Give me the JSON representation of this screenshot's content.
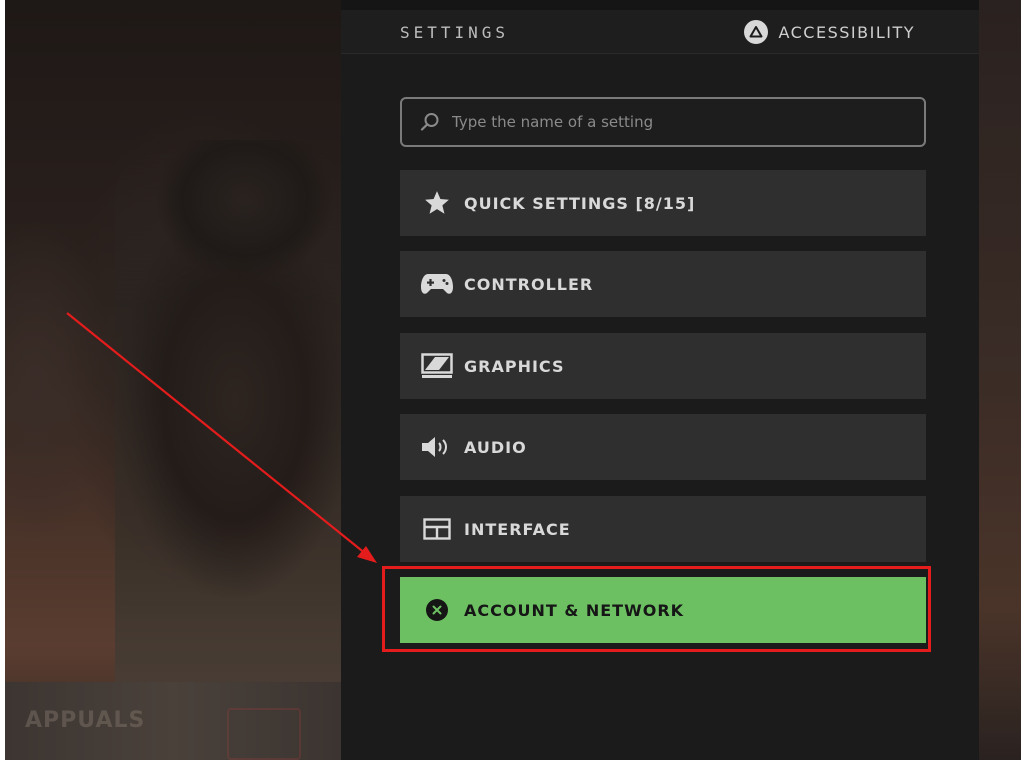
{
  "header": {
    "title": "SETTINGS",
    "accessibility_label": "ACCESSIBILITY"
  },
  "search": {
    "placeholder": "Type the name of a setting",
    "value": ""
  },
  "menu": {
    "items": [
      {
        "label": "QUICK SETTINGS [8/15]",
        "icon": "star-icon"
      },
      {
        "label": "CONTROLLER",
        "icon": "gamepad-icon"
      },
      {
        "label": "GRAPHICS",
        "icon": "monitor-icon"
      },
      {
        "label": "AUDIO",
        "icon": "speaker-icon"
      },
      {
        "label": "INTERFACE",
        "icon": "interface-icon"
      },
      {
        "label": "ACCOUNT & NETWORK",
        "icon": "x-circle-icon",
        "selected": true
      }
    ]
  },
  "watermark": {
    "text": "APPUALS"
  },
  "colors": {
    "accent_green": "#6cc062",
    "annotation_red": "#e41c1c",
    "panel_bg": "#1b1b1b",
    "item_bg": "#2f2f2f"
  }
}
